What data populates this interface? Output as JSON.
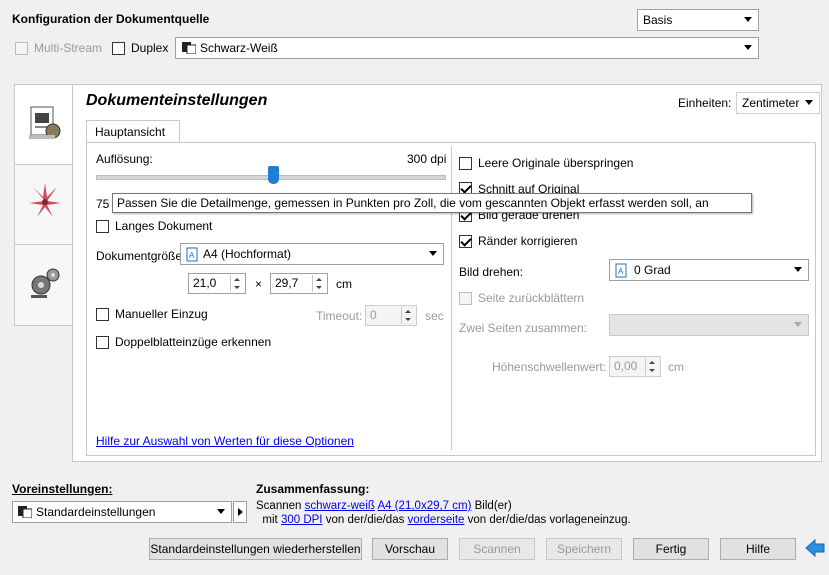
{
  "header": {
    "title": "Konfiguration der Dokumentquelle",
    "mode_select": "Basis"
  },
  "source": {
    "multistream_label": "Multi-Stream",
    "duplex_label": "Duplex",
    "color_mode": "Schwarz-Weiß"
  },
  "panel": {
    "title": "Dokumenteinstellungen",
    "units_label": "Einheiten:",
    "units_value": "Zentimeter",
    "tab_main": "Hauptansicht"
  },
  "left": {
    "resolution_label": "Auflösung:",
    "resolution_value": "300 dpi",
    "slider_min": "75",
    "slider_level_fraction": 0.51,
    "long_doc_label": "Langes Dokument",
    "doc_size_label": "Dokumentgröße:",
    "doc_size_value": "A4 (Hochformat)",
    "width_value": "21,0",
    "times": "×",
    "height_value": "29,7",
    "unit_cm": "cm",
    "manual_feed_label": "Manueller Einzug",
    "timeout_label": "Timeout:",
    "timeout_value": "0",
    "timeout_unit": "sec",
    "double_feed_label": "Doppelblatteinzüge erkennen",
    "help_link": "Hilfe zur Auswahl von Werten für diese Optionen"
  },
  "right": {
    "skip_blank_label": "Leere Originale überspringen",
    "crop_label": "Schnitt auf Original",
    "straighten_label": "Bild gerade drehen",
    "edges_label": "Ränder korrigieren",
    "rotate_label": "Bild drehen:",
    "rotate_value": "0 Grad",
    "flip_label": "Seite zurückblättern",
    "merge_label": "Zwei Seiten zusammen:",
    "threshold_label": "Höhenschwellenwert:",
    "threshold_value": "0,00",
    "threshold_unit": "cm"
  },
  "tooltip": {
    "text": "Passen Sie die Detailmenge, gemessen in Punkten pro Zoll, die vom gescannten Objekt erfasst werden soll, an"
  },
  "presets": {
    "label": "Voreinstellungen:",
    "value": "Standardeinstellungen"
  },
  "summary": {
    "label": "Zusammenfassung:",
    "scan_word": "Scannen",
    "mode_link": "schwarz-weiß",
    "size_link": "A4 (21,0x29,7 cm)",
    "suffix1": "Bild(er)",
    "with_word": "mit",
    "dpi_link": "300 DPI",
    "mid_text": "von der/die/das",
    "side_link": "vorderseite",
    "end_text": "von der/die/das vorlageneinzug."
  },
  "buttons": {
    "restore": "Standardeinstellungen wiederherstellen",
    "preview": "Vorschau",
    "scan": "Scannen",
    "save": "Speichern",
    "done": "Fertig",
    "help": "Hilfe"
  },
  "colors": {
    "accent": "#1e7fd6",
    "link": "#0000ee",
    "panel_bg": "#ffffff",
    "window_bg": "#f0f0f0"
  }
}
